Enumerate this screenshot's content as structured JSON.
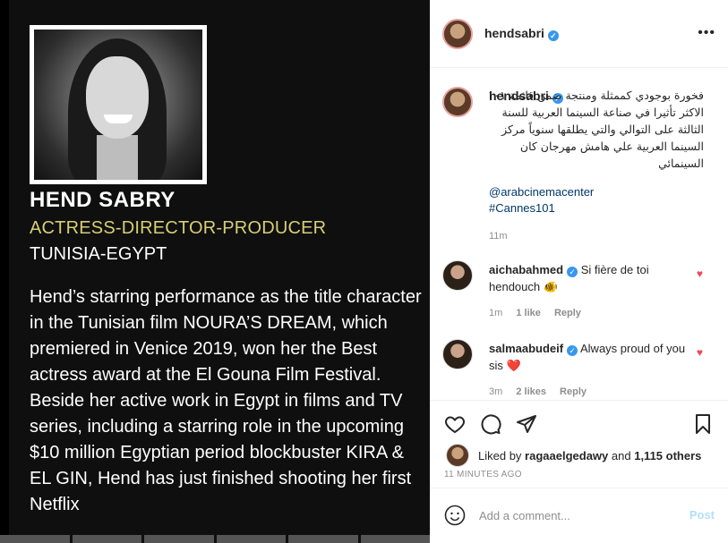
{
  "media": {
    "name": "HEND SABRY",
    "role": "ACTRESS-DIRECTOR-PRODUCER",
    "country": "TUNISIA-EGYPT",
    "bio": "Hend’s starring performance as the title character in the Tunisian film NOURA’S DREAM, which premiered in Venice 2019, won her the Best actress award at the El Gouna Film Festival. Beside her active work in Egypt in films and TV series, including a starring role in the upcoming $10 million Egyptian period blockbuster KIRA & EL GIN, Hend has just finished shooting her first Netflix"
  },
  "header": {
    "username": "hendsabri",
    "more": "•••"
  },
  "caption": {
    "username": "hendsabri",
    "text": "فخورة بوجودي كممثلة ومنتجة ضمن قائمة ١٠١ الاكثر تأثيرا في صناعة السينما العربية للسنة الثالثة على التوالي والتي يطلقها سنوياً مركز السينما العربية علي هامش مهرجان كان السينمائي",
    "mention": "@arabcinemacenter",
    "hashtag": "#Cannes101",
    "time": "11m"
  },
  "comments": [
    {
      "username": "aichabahmed",
      "text": "Si fière de toi hendouch 🐠",
      "time": "1m",
      "likes": "1 like",
      "reply": "Reply"
    },
    {
      "username": "salmaabudeif",
      "text": "Always proud of you sis ❤️",
      "time": "3m",
      "likes": "2 likes",
      "reply": "Reply"
    }
  ],
  "likes": {
    "prefix": "Liked by",
    "user": "ragaaelgedawy",
    "and": "and",
    "others": "1,115 others"
  },
  "timestamp": "11 MINUTES AGO",
  "composer": {
    "placeholder": "Add a comment...",
    "post_label": "Post"
  },
  "colors": {
    "accent_role": "#d6cf74",
    "link": "#00376b",
    "verified": "#3897f0",
    "heart": "#ed4956"
  }
}
